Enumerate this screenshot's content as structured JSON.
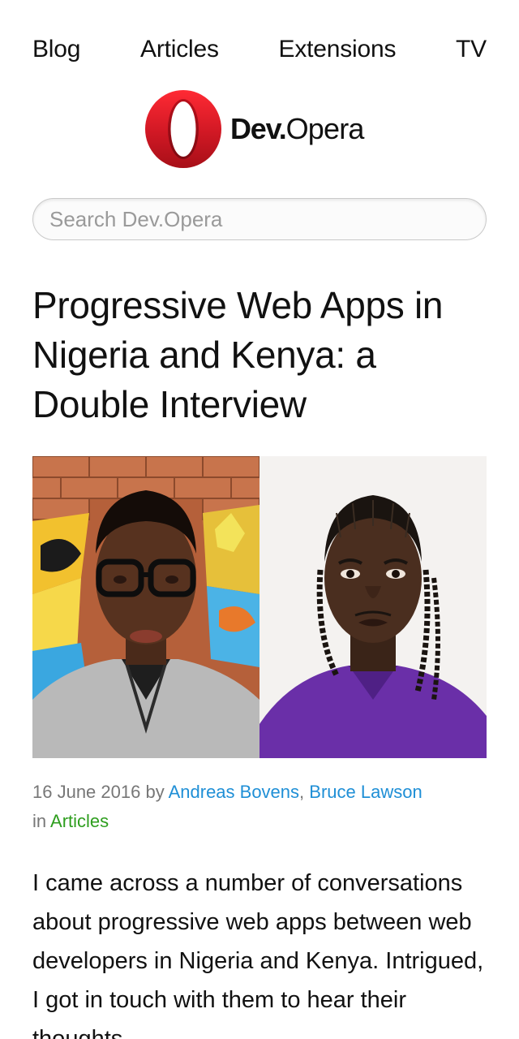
{
  "nav": {
    "items": [
      "Blog",
      "Articles",
      "Extensions",
      "TV"
    ]
  },
  "logo": {
    "text_bold": "Dev.",
    "text_regular": "Opera",
    "brand_color": "#d01824"
  },
  "search": {
    "placeholder": "Search Dev.Opera",
    "value": ""
  },
  "article": {
    "title": "Progressive Web Apps in Nigeria and Kenya: a Double Interview",
    "date": "16 June 2016",
    "by": " by ",
    "authors": [
      "Andreas Bovens",
      "Bruce Lawson"
    ],
    "author_separator": ", ",
    "in": "in ",
    "category": "Articles",
    "intro": "I came across a number of conversations about progressive web apps between web developers in Nigeria and Kenya. Intrigued, I got in touch with them to hear their thoughts"
  },
  "colors": {
    "link": "#1f8fd6",
    "category_link": "#2e9e1e",
    "meta_text": "#777777"
  }
}
